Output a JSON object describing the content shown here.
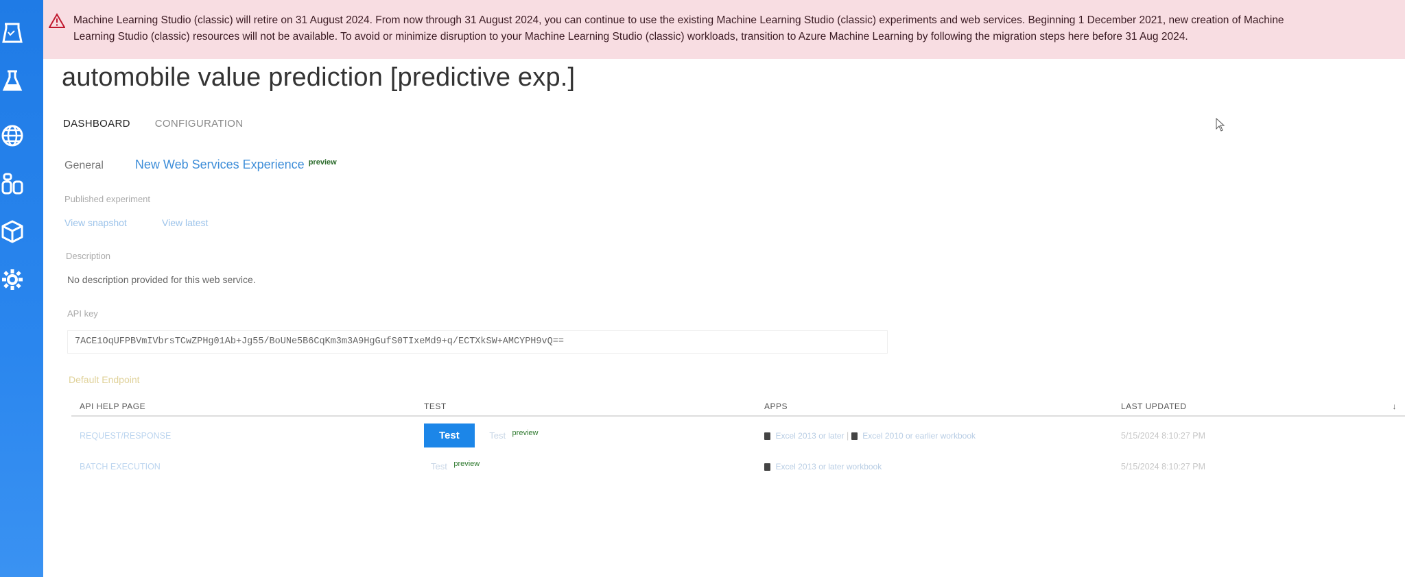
{
  "banner": {
    "icon": "warning-triangle-icon",
    "line1": "Machine Learning Studio (classic) will retire on 31 August 2024. From now through 31 August 2024, you can continue to use the existing Machine Learning Studio (classic) experiments and web services. Beginning 1 December 2021, new creation of Machine",
    "line2": "Learning Studio (classic) resources will not be available. To avoid or minimize disruption to your Machine Learning Studio (classic) workloads, transition to Azure Machine Learning by following the migration steps here before 31 Aug 2024."
  },
  "nav": {
    "icons": [
      "experiments-icon",
      "flask-icon",
      "globe-icon",
      "datasets-icon",
      "cube-icon",
      "gear-icon"
    ]
  },
  "page": {
    "title": "automobile value prediction [predictive exp.]"
  },
  "tabs": [
    {
      "label": "DASHBOARD"
    },
    {
      "label": "CONFIGURATION"
    }
  ],
  "subnav": {
    "general": "General",
    "new_experience": "New Web Services Experience",
    "badge": "preview"
  },
  "published": {
    "label": "Published experiment",
    "view_snapshot": "View snapshot",
    "view_latest": "View latest"
  },
  "description": {
    "label": "Description",
    "text": "No description provided for this web service."
  },
  "api_key": {
    "label": "API key",
    "value": "7ACE1OqUFPBVmIVbrsTCwZPHg01Ab+Jg55/BoUNe5B6CqKm3m3A9HgGufS0TIxeMd9+q/ECTXkSW+AMCYPH9vQ=="
  },
  "default_endpoint": {
    "label": "Default Endpoint"
  },
  "table": {
    "headers": [
      "API HELP PAGE",
      "TEST",
      "APPS",
      "LAST UPDATED"
    ],
    "rows": [
      {
        "name": "REQUEST/RESPONSE",
        "test_button": "Test",
        "test_link": "Test",
        "test_badge": "preview",
        "app1": "Excel 2013 or later",
        "app2": "Excel 2010 or earlier workbook",
        "updated": "5/15/2024 8:10:27 PM"
      },
      {
        "name": "BATCH EXECUTION",
        "test_link": "Test",
        "test_badge": "preview",
        "app1": "Excel 2013 or later workbook",
        "updated": "5/15/2024 8:10:27 PM"
      }
    ]
  },
  "colors": {
    "nav_blue": "#1f7be6",
    "banner_bg": "#f8dde2",
    "accent": "#1c86e8"
  }
}
